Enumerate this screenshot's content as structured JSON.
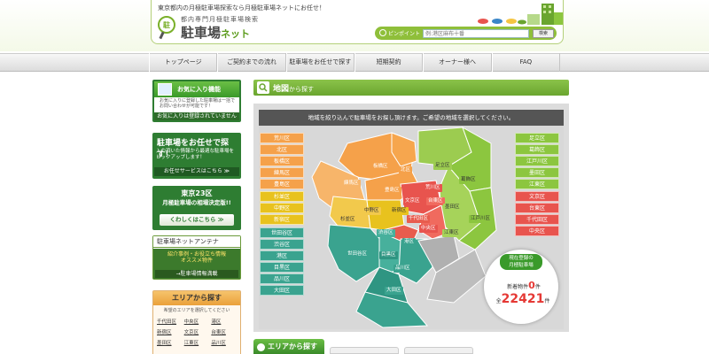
{
  "header": {
    "tagline": "東京都内の月極駐車場探索なら月極駐車場ネットにお任せ！",
    "logo_mark": "駐",
    "logo_sub": "都内専門月極駐車場検索",
    "logo_main": "駐車場",
    "logo_main_suffix": "ネット",
    "search_label": "ピンポイント",
    "search_placeholder": "例:港区麻布十番",
    "search_button": "検索"
  },
  "nav": [
    "トップページ",
    "ご契約までの流れ",
    "駐車場をお任せで探す",
    "短期契約",
    "オーナー様へ",
    "FAQ"
  ],
  "sidebar": {
    "favorites": {
      "title": "お気に入り機能",
      "text": "お気に入りに登録した駐車場は一括でお問い合わせが可能です！",
      "footer": "お気に入りは登録されていません"
    },
    "omakase": {
      "title": "駐車場をお任せで探す！",
      "text": "入力頂いた情報から最適な駐車場をピックアップします！",
      "button": "お任せサービスはこちら ≫"
    },
    "souba": {
      "title_line1": "東京23区",
      "title_line2": "月極駐車場の相場決定版!!",
      "button": "くわしくはこちら ≫"
    },
    "antenna": {
      "title": "駐車場ネットアンテナ",
      "text_line1": "紹介事例・お役立ち情報",
      "text_line2": "オススメ物件",
      "button": "→駐車場情報満載"
    },
    "area": {
      "title": "エリアから探す",
      "subtitle": "希望のエリアを選択してください",
      "links": [
        "千代田区",
        "中央区",
        "港区",
        "新宿区",
        "文京区",
        "台東区",
        "墨田区",
        "江東区",
        "品川区"
      ]
    }
  },
  "main": {
    "title": "地図",
    "title_suffix": "から探す",
    "instruction": "地域を絞り込んで駐車場をお探し頂けます。ご希望の地域を選択してください。",
    "legend_left_orange": [
      "荒川区",
      "北区",
      "板橋区",
      "練馬区",
      "豊島区"
    ],
    "legend_left_yellow": [
      "杉並区",
      "中野区",
      "新宿区"
    ],
    "legend_left_teal": [
      "世田谷区",
      "渋谷区",
      "港区",
      "目黒区",
      "品川区",
      "大田区"
    ],
    "legend_right_green": [
      "足立区",
      "葛飾区",
      "江戸川区",
      "墨田区",
      "江東区"
    ],
    "legend_right_red": [
      "文京区",
      "台東区",
      "千代田区",
      "中央区"
    ],
    "map_labels": [
      {
        "text": "北区",
        "color": "orange"
      },
      {
        "text": "板橋区",
        "color": "orange"
      },
      {
        "text": "足立区",
        "color": "green"
      },
      {
        "text": "葛飾区",
        "color": "green"
      },
      {
        "text": "練馬区",
        "color": "orange"
      },
      {
        "text": "豊島区",
        "color": "orange"
      },
      {
        "text": "荒川区",
        "color": "orange"
      },
      {
        "text": "文京区",
        "color": "red"
      },
      {
        "text": "台東区",
        "color": "red"
      },
      {
        "text": "墨田区",
        "color": "green"
      },
      {
        "text": "中野区",
        "color": "yellow"
      },
      {
        "text": "新宿区",
        "color": "yellow"
      },
      {
        "text": "杉並区",
        "color": "yellow"
      },
      {
        "text": "千代田区",
        "color": "red"
      },
      {
        "text": "江戸川区",
        "color": "green"
      },
      {
        "text": "中央区",
        "color": "red"
      },
      {
        "text": "江東区",
        "color": "green"
      },
      {
        "text": "渋谷区",
        "color": "teal"
      },
      {
        "text": "港区",
        "color": "teal"
      },
      {
        "text": "世田谷区",
        "color": "teal"
      },
      {
        "text": "目黒区",
        "color": "teal"
      },
      {
        "text": "品川区",
        "color": "teal"
      },
      {
        "text": "大田区",
        "color": "teal"
      }
    ],
    "counter": {
      "badge_line1": "現在登録の",
      "badge_line2": "月極駐車場",
      "new_prefix": "新着物件",
      "new_count": "0",
      "new_unit": "件",
      "total_prefix": "全",
      "total_count": "22421",
      "total_unit": "件"
    },
    "area_tab": "エリアから探す"
  },
  "colors": {
    "orange": "#f5a14a",
    "yellow": "#e8c21e",
    "teal": "#3aa38f",
    "green": "#8cc63f",
    "red": "#e8544e",
    "brand_green": "#3a9a2a"
  }
}
